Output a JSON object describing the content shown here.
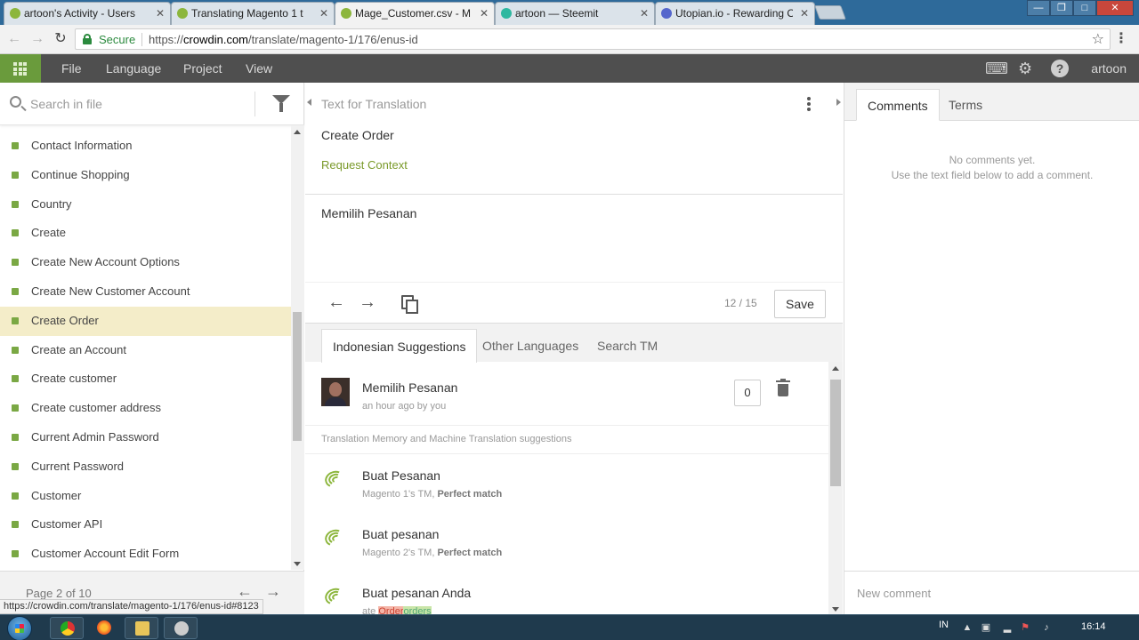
{
  "browser": {
    "tabs": [
      {
        "label": "artoon's Activity - Users",
        "close": "✕"
      },
      {
        "label": "Translating Magento 1 t",
        "close": "✕"
      },
      {
        "label": "Mage_Customer.csv - M",
        "close": "✕"
      },
      {
        "label": "artoon — Steemit",
        "close": "✕"
      },
      {
        "label": "Utopian.io - Rewarding O",
        "close": "✕"
      }
    ],
    "secure_label": "Secure",
    "url_scheme": "https://",
    "url_host": "crowdin.com",
    "url_path": "/translate/magento-1/176/enus-id",
    "status_url": "https://crowdin.com/translate/magento-1/176/enus-id#8123"
  },
  "appbar": {
    "menu": [
      "File",
      "Language",
      "Project",
      "View"
    ],
    "user": "artoon",
    "accent_color": "#6a9b3c"
  },
  "left": {
    "search_placeholder": "Search in file",
    "strings": [
      "Contact Information",
      "Continue Shopping",
      "Country",
      "Create",
      "Create New Account Options",
      "Create New Customer Account",
      "Create Order",
      "Create an Account",
      "Create customer",
      "Create customer address",
      "Current Admin Password",
      "Current Password",
      "Customer",
      "Customer API",
      "Customer Account Edit Form"
    ],
    "selected_index": 6,
    "pager": "Page 2 of 10"
  },
  "editor": {
    "source_header": "Text for Translation",
    "source_text": "Create Order",
    "request_context": "Request Context",
    "translation_text": "Memilih Pesanan",
    "counter": "12 / 15",
    "save_label": "Save",
    "tabs": [
      "Indonesian Suggestions",
      "Other Languages",
      "Search TM"
    ],
    "my_suggestion": {
      "text": "Memilih Pesanan",
      "meta": "an hour ago by you",
      "votes": "0"
    },
    "tm_header": "Translation Memory and Machine Translation suggestions",
    "tm_items": [
      {
        "text": "Buat Pesanan",
        "source": "Magento 1's TM,",
        "match": "Perfect match"
      },
      {
        "text": "Buat pesanan",
        "source": "Magento 2's TM,",
        "match": "Perfect match"
      },
      {
        "text": "Buat pesanan Anda",
        "prefix": "ate ",
        "del": "Order",
        "ins": "orders"
      }
    ]
  },
  "right": {
    "tabs": [
      "Comments",
      "Terms"
    ],
    "no_comments_1": "No comments yet.",
    "no_comments_2": "Use the text field below to add a comment.",
    "comment_placeholder": "New comment"
  },
  "taskbar": {
    "lang": "IN",
    "time": "16:14"
  }
}
